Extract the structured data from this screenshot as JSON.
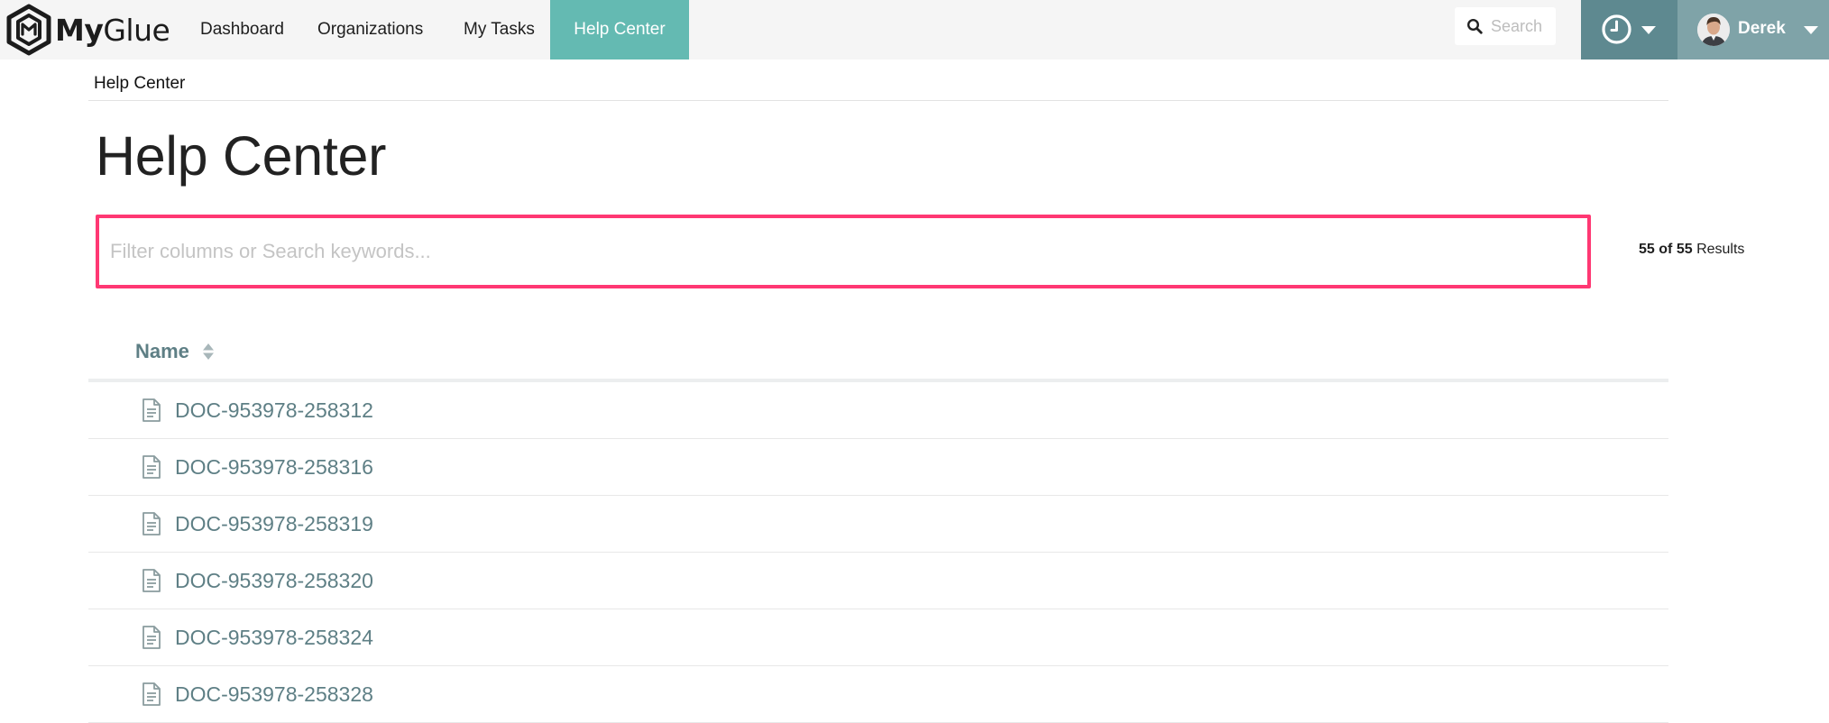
{
  "app": {
    "logo_bold": "My",
    "logo_light": "Glue"
  },
  "nav": {
    "items": [
      {
        "label": "Dashboard",
        "active": false
      },
      {
        "label": "Organizations",
        "active": false
      },
      {
        "label": "My Tasks",
        "active": false
      },
      {
        "label": "Help Center",
        "active": true
      }
    ],
    "search_placeholder": "Search",
    "user_name": "Derek"
  },
  "breadcrumb": "Help Center",
  "page_title": "Help Center",
  "filter": {
    "placeholder": "Filter columns or Search keywords...",
    "value": ""
  },
  "results": {
    "shown": "55",
    "of_label": "of",
    "total": "55",
    "label": "Results"
  },
  "table": {
    "column_name": "Name",
    "rows": [
      {
        "name": "DOC-953978-258312"
      },
      {
        "name": "DOC-953978-258316"
      },
      {
        "name": "DOC-953978-258319"
      },
      {
        "name": "DOC-953978-258320"
      },
      {
        "name": "DOC-953978-258324"
      },
      {
        "name": "DOC-953978-258328"
      }
    ]
  },
  "colors": {
    "nav_bg": "#f5f5f5",
    "nav_active": "#64bab2",
    "clock_bg": "#5e8990",
    "user_bg": "#7fa3a8",
    "filter_border": "#ff3873",
    "link": "#5e7f85"
  },
  "icons": {
    "logo": "myglue-hex-logo-icon",
    "search": "search-icon",
    "clock": "clock-icon",
    "caret": "caret-down-icon",
    "sort": "sort-icon",
    "document": "document-icon"
  }
}
